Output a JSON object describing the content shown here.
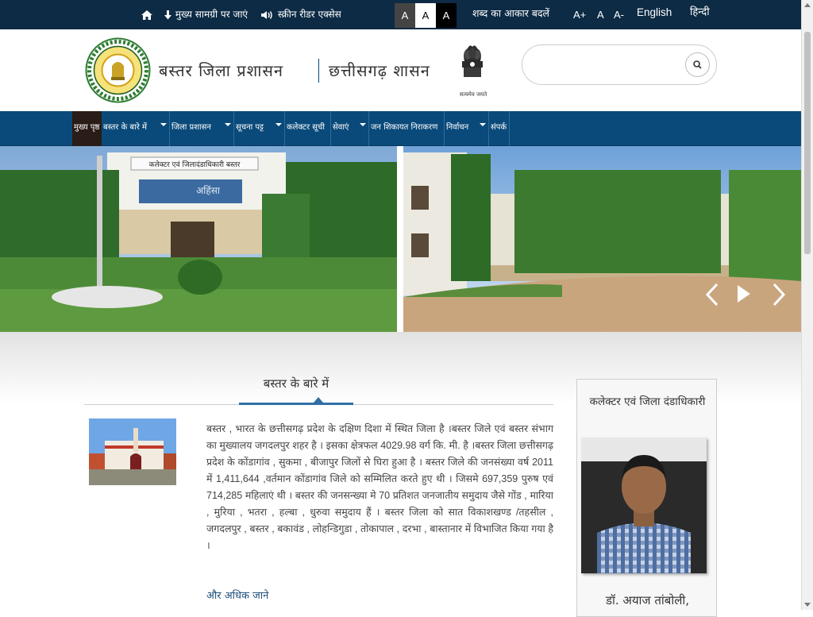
{
  "topbar": {
    "skip_to_content": "मुख्य सामग्री पर जाएं",
    "screen_reader": "स्क्रीन रीडर एक्सेस",
    "contrast_options": [
      "A",
      "A",
      "A"
    ],
    "text_size_label": "शब्द का आकार बदलें",
    "text_sizes": [
      "A+",
      "A",
      "A-"
    ],
    "lang_english": "English",
    "lang_hindi": "हिन्दी"
  },
  "header": {
    "district_title": "बस्तर जिला प्रशासन",
    "state_title": "छत्तीसगढ़ शासन",
    "emblem_motto": "सत्यमेव जयते",
    "logo_text": "छत्तीसगढ़ शासन",
    "search_placeholder": ""
  },
  "nav": {
    "items": [
      {
        "label": "मुख्य पृष्ठ"
      },
      {
        "label": "बस्तर के बारे में"
      },
      {
        "label": "जिला प्रशासन"
      },
      {
        "label": "सूचना पट्ट"
      },
      {
        "label": "कलेक्टर सूची"
      },
      {
        "label": "सेवाएं"
      },
      {
        "label": "जन शिकायत निराकरण"
      },
      {
        "label": "निर्वाचन"
      },
      {
        "label": "संपर्क"
      }
    ]
  },
  "banner": {
    "building_sign": "कलेक्टर एवं जिलादंडाधिकारी बस्तर",
    "banner_text": "अहिंसा"
  },
  "about": {
    "heading": "बस्तर के बारे में",
    "paragraph": "बस्तर , भारत के छत्तीसगढ़ प्रदेश के दक्षिण दिशा में स्थित जिला है ।बस्तर जिले एवं बस्तर संभाग का मुख्यालय जगदलपुर शहर है । इसका क्षेत्रफल 4029.98 वर्ग कि. मी. है ।बस्तर जिला छत्तीसगढ़ प्रदेश के कोंडागांव , सुकमा , बीजापुर जिलों से घिरा हुआ है । बस्तर जिले की जनसंख्या वर्ष 2011 में 1,411,644 ,वर्तमान कोंडागांव जिले को सम्मिलित करते हुए थी । जिसमे 697,359 पुरुष एवं 714,285 महिलाएं थी । बस्तर की जनसन्ख्या मे 70 प्रतिशत जनजातीय समुदाय जैसे गोंड , मारिया , मुरिया , भतरा , हल्बा , धुरुवा समुदाय हैं । बस्तर जिला को सात विकाशखण्ड /तहसील , जगदलपुर , बस्तर , बकावंड , लोहन्डिगुडा , तोकापाल , दरभा , बास्तानार में विभाजित किया गया है ।",
    "read_more": "और अधिक जाने"
  },
  "collector": {
    "heading": "कलेक्टर एवं जिला दंडाधिकारी",
    "name": "डॉ. अयाज तांबोली,"
  },
  "colors": {
    "topbar": "#0d2b45",
    "nav": "#0a4a7a",
    "nav_active": "#2a1c16",
    "link": "#1f4e79",
    "accent_underline": "#2f6fa5"
  }
}
